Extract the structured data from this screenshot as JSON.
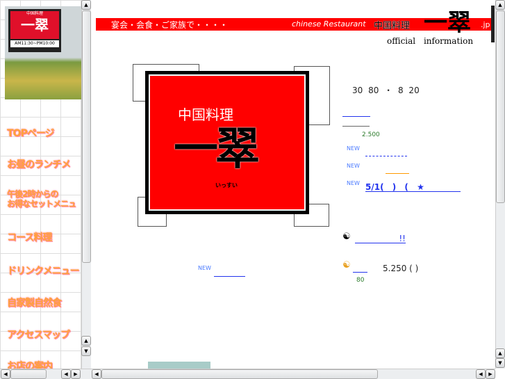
{
  "sidebar": {
    "photo": {
      "sign_top": "中国料理",
      "sign_name": "一翠",
      "hours": "AM11:30~PM10:00"
    },
    "items": [
      "TOPページ",
      "お昼のランチメ",
      "午後2時からの",
      "お得なセットメニュ",
      "コース料理",
      "ドリンクメニュー",
      "自家製自然食",
      "アクセスマップ",
      "お店の案内"
    ]
  },
  "header": {
    "tagline": "宴会・会食・ご家族で・・・・",
    "subtitle": "chinese Restaurant",
    "kanji": "中国料理",
    "name": "一翠",
    "domain": ".jp",
    "official": "official information"
  },
  "logo": {
    "kanji": "中国料理",
    "name": "一翠",
    "kana": "いっすい"
  },
  "main": {
    "hours": "30 80 ・ 8 20",
    "price1": "2.500",
    "new_label": "NEW",
    "news3": "5/1( ) ( ★",
    "notice1_suffix": "!!",
    "price2": "5.250 ( )",
    "count": "80"
  },
  "colors": {
    "accent": "#ff0000",
    "link": "#2233ee",
    "new": "#4a7aff"
  }
}
